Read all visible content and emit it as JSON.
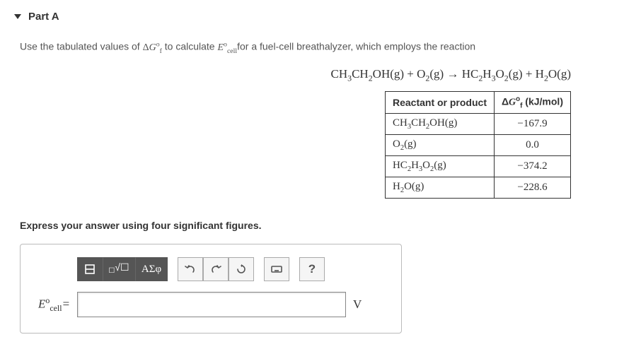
{
  "header": {
    "part": "Part A"
  },
  "prompt": {
    "pre": "Use the tabulated values of ",
    "deltaG_html": "Δ<span class='serif-it'>G</span><span class='sup'>o</span><span class='sub'>f</span>",
    "mid": " to calculate ",
    "Ecell_html": "<span class='serif-it'>E</span><span class='sup'>o</span><span class='sub'>cell</span>",
    "post": "for a fuel-cell breathalyzer, which employs the reaction"
  },
  "equation_html": "CH<span class='sub'>3</span>CH<span class='sub'>2</span>OH(g) + O<span class='sub'>2</span>(g) → HC<span class='sub'>2</span>H<span class='sub'>3</span>O<span class='sub'>2</span>(g) + H<span class='sub'>2</span>O(g)",
  "table": {
    "head": {
      "col1": "Reactant or product",
      "col2_html": "Δ<span class='serif-it'>G</span><span class='sup'>o</span><span class='sub'>f</span> (kJ/mol)"
    },
    "rows": [
      {
        "species_html": "CH<span class='sub'>3</span>CH<span class='sub'>2</span>OH(g)",
        "value": "−167.9"
      },
      {
        "species_html": "O<span class='sub'>2</span>(g)",
        "value": "0.0"
      },
      {
        "species_html": "HC<span class='sub'>2</span>H<span class='sub'>3</span>O<span class='sub'>2</span>(g)",
        "value": "−374.2"
      },
      {
        "species_html": "H<span class='sub'>2</span>O(g)",
        "value": "−228.6"
      }
    ]
  },
  "instruction": "Express your answer using four significant figures.",
  "toolbar": {
    "template_label": "",
    "fraction_label_html": "<span style='font-size:10px'>☐</span><span style='font-size:14px;position:relative;top:-3px'>√☐</span>",
    "symbols_label": "ΑΣφ"
  },
  "answer": {
    "label_html": "<span class='serif-it'>E</span><span class='sup' style='font-style:normal'>o</span><span class='sub' style='font-style:normal'>cell</span>=",
    "value": "",
    "unit": "V"
  }
}
